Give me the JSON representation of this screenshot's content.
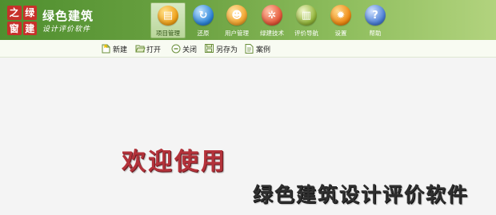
{
  "logo": {
    "chars": [
      "之",
      "绿",
      "窗",
      "建"
    ]
  },
  "brand": {
    "title": "绿色建筑",
    "subtitle": "设计评价软件"
  },
  "nav": [
    {
      "label": "项目管理",
      "icon": "project-folder-icon",
      "color": "#f0a21a",
      "glyph": "▤",
      "active": true
    },
    {
      "label": "还原",
      "icon": "restore-icon",
      "color": "#2f86d8",
      "glyph": "↻",
      "active": false
    },
    {
      "label": "用户管理",
      "icon": "user-icon",
      "color": "#f3a630",
      "glyph": "☻",
      "active": false
    },
    {
      "label": "绿建技术",
      "icon": "tech-network-icon",
      "color": "#e5583a",
      "glyph": "✲",
      "active": false
    },
    {
      "label": "评价导航",
      "icon": "book-icon",
      "color": "#93b63a",
      "glyph": "▥",
      "active": false
    },
    {
      "label": "设置",
      "icon": "gear-icon",
      "color": "#f08a14",
      "glyph": "✹",
      "active": false
    },
    {
      "label": "帮助",
      "icon": "help-icon",
      "color": "#4b7fd6",
      "glyph": "?",
      "active": false
    }
  ],
  "toolbar": {
    "new_label": "新建",
    "open_label": "打开",
    "close_label": "关闭",
    "saveas_label": "另存为",
    "case_label": "案例"
  },
  "main": {
    "welcome": "欢迎使用",
    "product_name": "绿色建筑设计评价软件"
  }
}
